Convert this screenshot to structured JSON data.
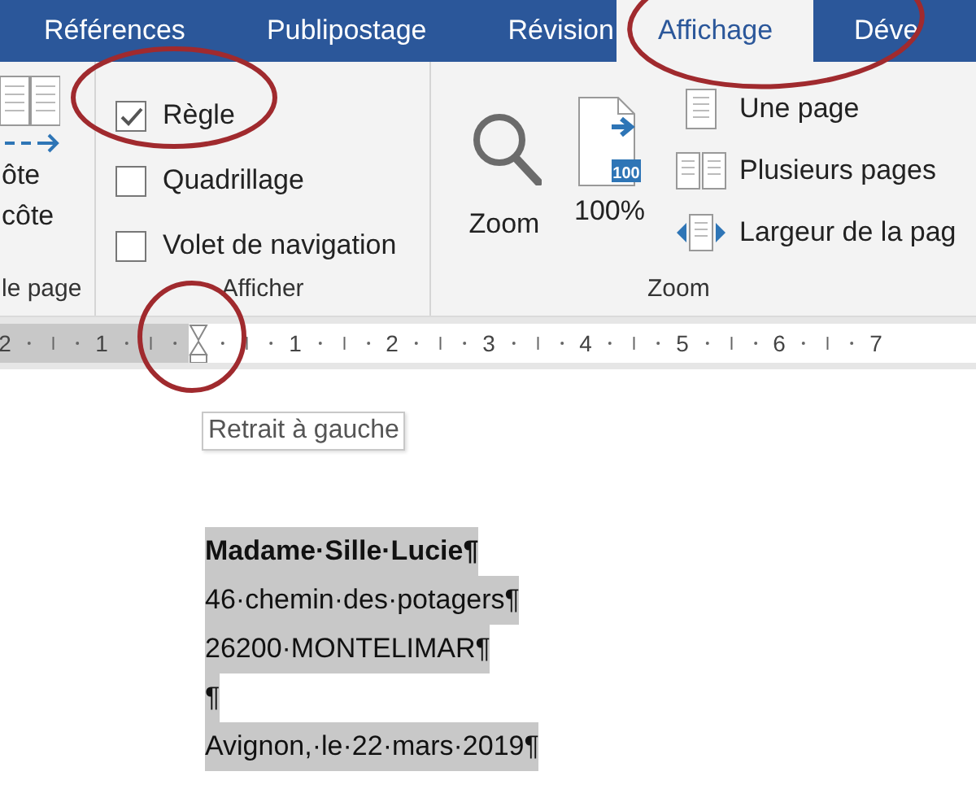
{
  "tabs": [
    {
      "label": "Références",
      "selected": false
    },
    {
      "label": "Publipostage",
      "selected": false
    },
    {
      "label": "Révision",
      "selected": false
    },
    {
      "label": "Affichage",
      "selected": true
    },
    {
      "label": "Déve",
      "selected": false
    }
  ],
  "ribbon": {
    "groups": [
      {
        "kind": "partial",
        "label": "le page",
        "button_lines": [
          "ôte",
          "côte"
        ]
      },
      {
        "kind": "checks",
        "label": "Afficher",
        "options": [
          {
            "label": "Règle",
            "checked": true
          },
          {
            "label": "Quadrillage",
            "checked": false
          },
          {
            "label": "Volet de navigation",
            "checked": false
          }
        ]
      },
      {
        "kind": "zoom",
        "label": "Zoom",
        "big_buttons": [
          {
            "kind": "magnifier",
            "label": "Zoom"
          },
          {
            "kind": "percent",
            "label": "100%",
            "badge": "100"
          }
        ],
        "small_buttons": [
          {
            "kind": "one",
            "label": "Une page"
          },
          {
            "kind": "multi",
            "label": "Plusieurs pages"
          },
          {
            "kind": "width",
            "label": "Largeur de la pag"
          }
        ]
      }
    ]
  },
  "ruler": {
    "left_labels": [
      "2",
      "1"
    ],
    "right_labels": [
      "1",
      "2",
      "3",
      "4",
      "5",
      "6",
      "7"
    ]
  },
  "tooltip": "Retrait à gauche",
  "document": {
    "lines": [
      {
        "text": "Madame·Sille·Lucie¶",
        "bold": true
      },
      {
        "text": "46·chemin·des·potagers¶",
        "bold": false
      },
      {
        "text": "26200·MONTELIMAR¶",
        "bold": false
      },
      {
        "text": "¶",
        "bold": false
      },
      {
        "text": "Avignon,·le·22·mars·2019¶",
        "bold": false
      }
    ]
  }
}
